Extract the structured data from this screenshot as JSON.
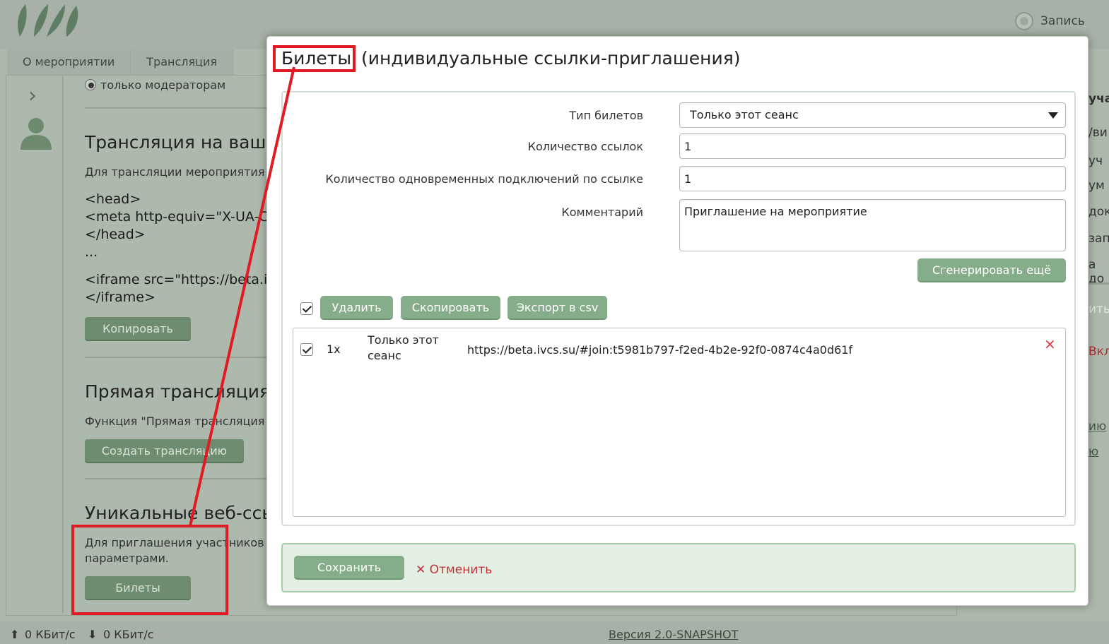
{
  "header": {
    "record_label": "Запись",
    "record_icon": "record-radio-icon"
  },
  "tabs": [
    "О мероприятии",
    "Трансляция"
  ],
  "background": {
    "radio_label": "только модераторам",
    "section1_title": "Трансляция на ваше",
    "section1_text": "Для трансляции мероприятия",
    "code_lines": [
      "<head>",
      "<meta http-equiv=\"X-UA-C",
      "</head>",
      "...",
      "",
      "<iframe src=\"https://beta.i",
      "</iframe>"
    ],
    "copy_button": "Копировать",
    "section2_title": "Прямая трансляция",
    "section2_text": "Функция \"Прямая трансляция",
    "create_button": "Создать трансляцию",
    "section3_title": "Уникальные веб-ссы",
    "section3_text_1": "Для приглашения участников",
    "section3_text_2": "параметрами.",
    "tickets_button": "Билеты"
  },
  "right_strip": [
    "учас",
    "/ви",
    "уч",
    "ум",
    "док",
    "запи",
    "а до",
    "ить",
    "Вкл",
    "ию",
    "ю"
  ],
  "modal": {
    "title_highlight": "Билеты",
    "title_rest": " (индивидуальные ссылки-приглашения)",
    "form": {
      "ticket_type_label": "Тип билетов",
      "ticket_type_value": "Только этот сеанс",
      "links_count_label": "Количество ссылок",
      "links_count_value": "1",
      "concurrent_label": "Количество одновременных подключений по ссылке",
      "concurrent_value": "1",
      "comment_label": "Комментарий",
      "comment_value": "Приглашение на мероприятие",
      "generate_button": "Сгенерировать ещё"
    },
    "toolbar": {
      "delete_button": "Удалить",
      "copy_button": "Скопировать",
      "export_button": "Экспорт в csv"
    },
    "rows": [
      {
        "count": "1x",
        "type_line1": "Только этот",
        "type_line2": "сеанс",
        "url": "https://beta.ivcs.su/#join:t5981b797-f2ed-4b2e-92f0-0874c4a0d61f",
        "delete_icon": "×"
      }
    ],
    "save_button": "Сохранить",
    "cancel_label": "Отменить",
    "cancel_icon": "✕"
  },
  "footer": {
    "upload_speed": "0 КБит/с",
    "download_speed": "0 КБит/с",
    "version": "Версия 2.0-SNAPSHOT"
  },
  "colors": {
    "accent_green": "#86ad8a",
    "annotation_red": "#e01b24",
    "cancel_red": "#c2303a"
  }
}
